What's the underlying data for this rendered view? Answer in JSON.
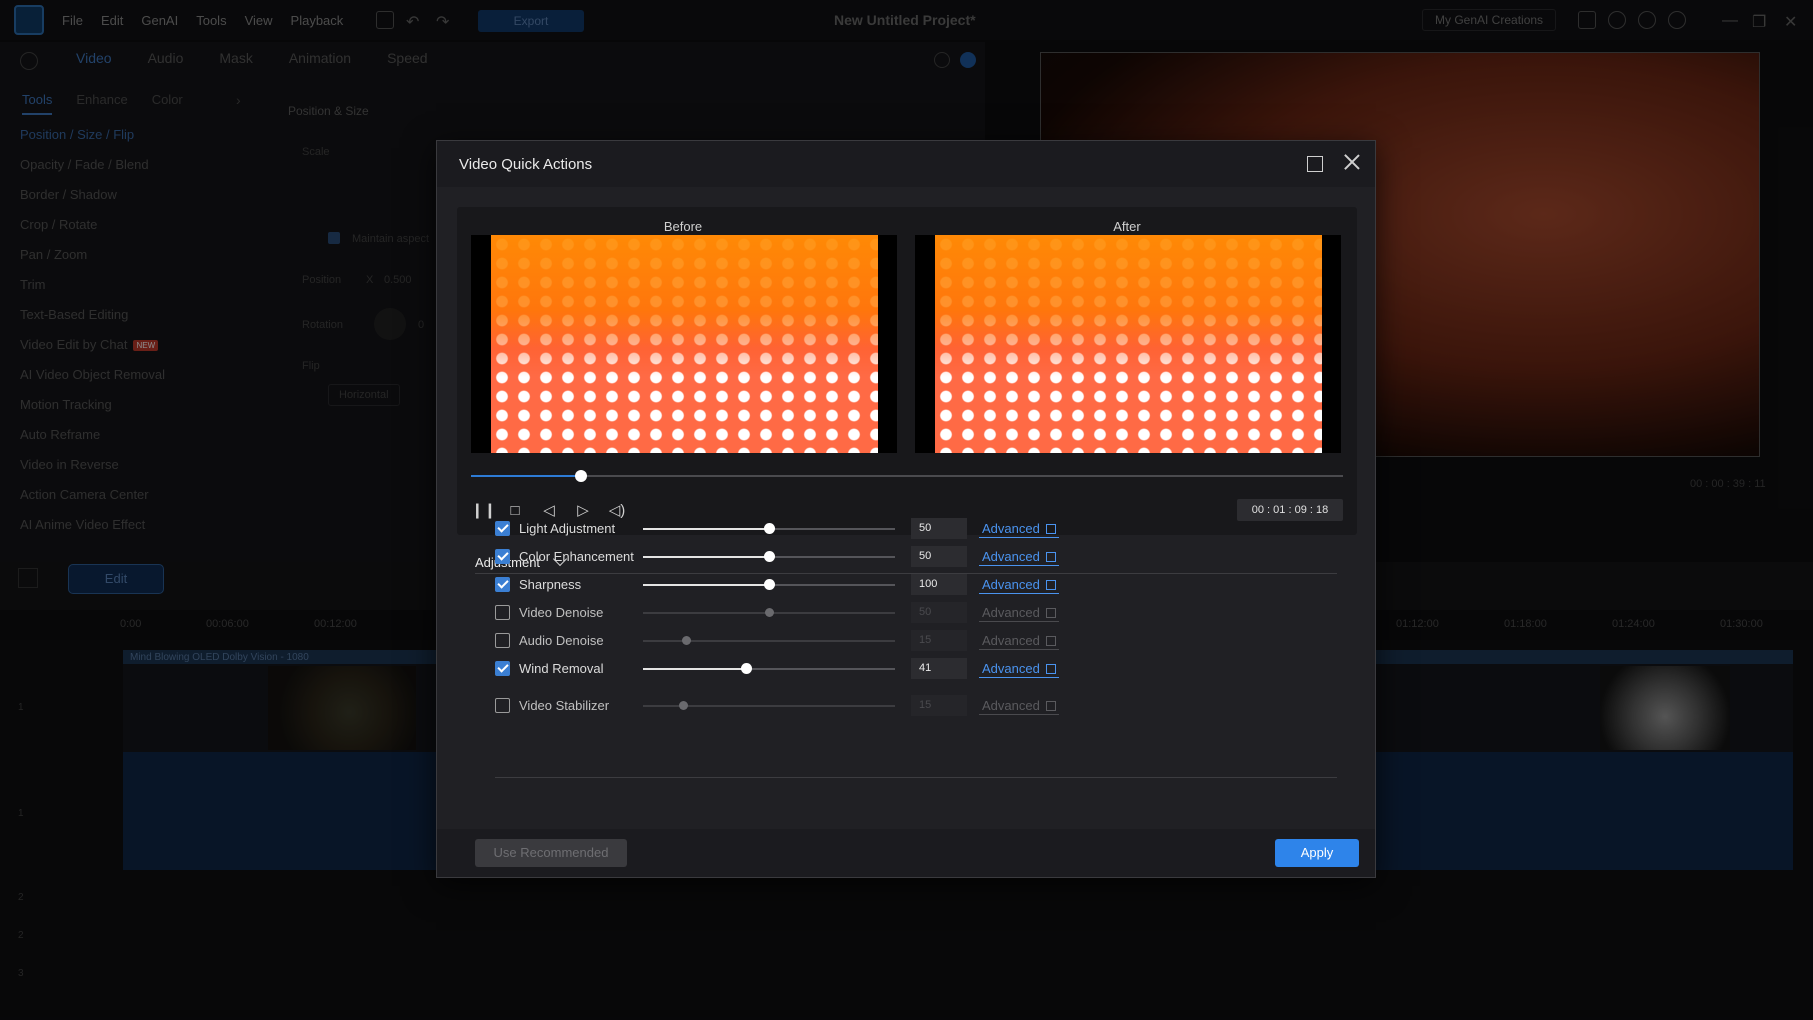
{
  "menubar": {
    "items": [
      "File",
      "Edit",
      "GenAI",
      "Tools",
      "View",
      "Playback"
    ],
    "export_label": "Export",
    "project_title": "New Untitled Project*",
    "genai_creations": "My GenAI Creations"
  },
  "left_panel": {
    "tabs": [
      "Video",
      "Audio",
      "Mask",
      "Animation",
      "Speed"
    ],
    "tool_tabs": [
      "Tools",
      "Enhance",
      "Color"
    ],
    "tools": [
      "Position / Size / Flip",
      "Opacity / Fade / Blend",
      "Border / Shadow",
      "Crop / Rotate",
      "Pan / Zoom",
      "Trim",
      "Text-Based Editing",
      "Video Edit by Chat",
      "AI Video Object Removal",
      "Motion Tracking",
      "Auto Reframe",
      "Video in Reverse",
      "Action Camera Center",
      "AI Anime Video Effect"
    ],
    "new_badge": "NEW",
    "section_title": "Position & Size",
    "scale_label": "Scale",
    "maintain_aspect": "Maintain aspect",
    "position_label": "Position",
    "position_x_label": "X",
    "position_x": "0.500",
    "rotation_label": "Rotation",
    "rotation_value": "0",
    "flip_label": "Flip",
    "flip_horizontal": "Horizontal"
  },
  "preview": {
    "timecode": "00 : 00 : 39 : 11"
  },
  "timeline": {
    "edit_label": "Edit",
    "ruler": [
      "0:00",
      "00:06:00",
      "00:12:00",
      "01:12:00",
      "01:18:00",
      "01:24:00",
      "01:30:00"
    ],
    "clip_title": "Mind Blowing OLED Dolby Vision - 1080",
    "track_numbers": [
      "1",
      "1",
      "2",
      "2",
      "3"
    ]
  },
  "dialog": {
    "title": "Video Quick Actions",
    "before_label": "Before",
    "after_label": "After",
    "scrub_progress": 0.126,
    "time_display": "00 : 01 : 09 : 18",
    "adjustment_header": "Adjustment",
    "advanced_label": "Advanced",
    "rows": [
      {
        "label": "Light Adjustment",
        "checked": true,
        "value": "50",
        "level": 0.5
      },
      {
        "label": "Color Enhancement",
        "checked": true,
        "value": "50",
        "level": 0.5
      },
      {
        "label": "Sharpness",
        "checked": true,
        "value": "100",
        "level": 0.5
      },
      {
        "label": "Video Denoise",
        "checked": false,
        "value": "50",
        "level": 0.5
      },
      {
        "label": "Audio Denoise",
        "checked": false,
        "value": "15",
        "level": 0.17
      },
      {
        "label": "Wind Removal",
        "checked": true,
        "value": "41",
        "level": 0.41
      }
    ],
    "stabilizer": {
      "label": "Video Stabilizer",
      "checked": false,
      "value": "15",
      "level": 0.16
    },
    "use_recommended_label": "Use Recommended",
    "apply_label": "Apply"
  }
}
